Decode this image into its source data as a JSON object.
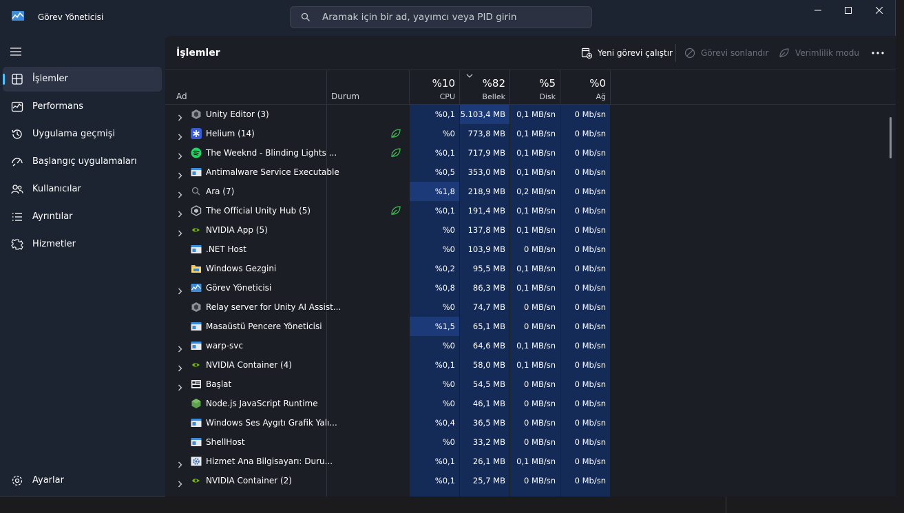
{
  "window": {
    "title": "Görev Yöneticisi",
    "search_placeholder": "Aramak için bir ad, yayımcı veya PID girin"
  },
  "sidebar": {
    "items": [
      {
        "label": "İşlemler",
        "icon": "processes-icon",
        "active": true
      },
      {
        "label": "Performans",
        "icon": "performance-icon"
      },
      {
        "label": "Uygulama geçmişi",
        "icon": "history-icon"
      },
      {
        "label": "Başlangıç uygulamaları",
        "icon": "startup-icon"
      },
      {
        "label": "Kullanıcılar",
        "icon": "users-icon"
      },
      {
        "label": "Ayrıntılar",
        "icon": "details-icon"
      },
      {
        "label": "Hizmetler",
        "icon": "services-icon"
      }
    ],
    "settings_label": "Ayarlar"
  },
  "toolbar": {
    "page_title": "İşlemler",
    "run_new_task": "Yeni görevi çalıştır",
    "end_task": "Görevi sonlandır",
    "efficiency_mode": "Verimlilik modu"
  },
  "columns": {
    "name": "Ad",
    "status": "Durum",
    "cpu": {
      "pct": "%10",
      "label": "CPU"
    },
    "memory": {
      "pct": "%82",
      "label": "Bellek"
    },
    "disk": {
      "pct": "%5",
      "label": "Disk"
    },
    "network": {
      "pct": "%0",
      "label": "Ağ"
    }
  },
  "colors": {
    "accent": "#4cc2ff",
    "highlight": "#1c3a78",
    "eco_green": "#3fb950"
  },
  "processes": [
    {
      "name": "Unity Editor (3)",
      "icon": "unity-icon",
      "expand": true,
      "eco": false,
      "cpu": "%0,1",
      "mem": "5.103,4 MB",
      "disk": "0,1 MB/sn",
      "net": "0 Mb/sn",
      "mem_hi": true
    },
    {
      "name": "Helium (14)",
      "icon": "helium-icon",
      "expand": true,
      "eco": true,
      "cpu": "%0",
      "mem": "773,8 MB",
      "disk": "0,1 MB/sn",
      "net": "0 Mb/sn"
    },
    {
      "name": "The Weeknd - Blinding Lights ...",
      "icon": "spotify-icon",
      "expand": true,
      "eco": true,
      "cpu": "%0,1",
      "mem": "717,9 MB",
      "disk": "0,1 MB/sn",
      "net": "0 Mb/sn"
    },
    {
      "name": "Antimalware Service Executable",
      "icon": "window-app-icon",
      "expand": true,
      "eco": false,
      "cpu": "%0,5",
      "mem": "353,0 MB",
      "disk": "0,1 MB/sn",
      "net": "0 Mb/sn"
    },
    {
      "name": "Ara (7)",
      "icon": "search-icon",
      "expand": true,
      "eco": false,
      "cpu": "%1,8",
      "mem": "218,9 MB",
      "disk": "0,2 MB/sn",
      "net": "0 Mb/sn",
      "cpu_hi": true
    },
    {
      "name": "The Official Unity Hub (5)",
      "icon": "unity-hub-icon",
      "expand": true,
      "eco": true,
      "cpu": "%0,1",
      "mem": "191,4 MB",
      "disk": "0,1 MB/sn",
      "net": "0 Mb/sn"
    },
    {
      "name": "NVIDIA App (5)",
      "icon": "nvidia-icon",
      "expand": true,
      "eco": false,
      "cpu": "%0",
      "mem": "137,8 MB",
      "disk": "0,1 MB/sn",
      "net": "0 Mb/sn"
    },
    {
      "name": ".NET Host",
      "icon": "window-app-icon",
      "expand": false,
      "eco": false,
      "cpu": "%0",
      "mem": "103,9 MB",
      "disk": "0 MB/sn",
      "net": "0 Mb/sn"
    },
    {
      "name": "Windows Gezgini",
      "icon": "folder-icon",
      "expand": false,
      "eco": false,
      "cpu": "%0,2",
      "mem": "95,5 MB",
      "disk": "0,1 MB/sn",
      "net": "0 Mb/sn"
    },
    {
      "name": "Görev Yöneticisi",
      "icon": "task-manager-icon",
      "expand": true,
      "eco": false,
      "cpu": "%0,8",
      "mem": "86,3 MB",
      "disk": "0,1 MB/sn",
      "net": "0 Mb/sn"
    },
    {
      "name": "Relay server for Unity AI Assist...",
      "icon": "unity-icon",
      "expand": false,
      "eco": false,
      "cpu": "%0",
      "mem": "74,7 MB",
      "disk": "0 MB/sn",
      "net": "0 Mb/sn"
    },
    {
      "name": "Masaüstü Pencere Yöneticisi",
      "icon": "window-app-icon",
      "expand": false,
      "eco": false,
      "cpu": "%1,5",
      "mem": "65,1 MB",
      "disk": "0 MB/sn",
      "net": "0 Mb/sn",
      "cpu_hi": true
    },
    {
      "name": "warp-svc",
      "icon": "window-app-icon",
      "expand": true,
      "eco": false,
      "cpu": "%0",
      "mem": "64,6 MB",
      "disk": "0,1 MB/sn",
      "net": "0 Mb/sn"
    },
    {
      "name": "NVIDIA Container (4)",
      "icon": "nvidia-icon",
      "expand": true,
      "eco": false,
      "cpu": "%0,1",
      "mem": "58,0 MB",
      "disk": "0,1 MB/sn",
      "net": "0 Mb/sn"
    },
    {
      "name": "Başlat",
      "icon": "start-icon",
      "expand": true,
      "eco": false,
      "cpu": "%0",
      "mem": "54,5 MB",
      "disk": "0 MB/sn",
      "net": "0 Mb/sn"
    },
    {
      "name": "Node.js JavaScript Runtime",
      "icon": "nodejs-icon",
      "expand": false,
      "eco": false,
      "cpu": "%0",
      "mem": "46,1 MB",
      "disk": "0 MB/sn",
      "net": "0 Mb/sn"
    },
    {
      "name": "Windows Ses Aygıtı Grafik Yalı...",
      "icon": "window-app-icon",
      "expand": false,
      "eco": false,
      "cpu": "%0,4",
      "mem": "36,5 MB",
      "disk": "0 MB/sn",
      "net": "0 Mb/sn"
    },
    {
      "name": "ShellHost",
      "icon": "window-app-icon",
      "expand": false,
      "eco": false,
      "cpu": "%0",
      "mem": "33,2 MB",
      "disk": "0 MB/sn",
      "net": "0 Mb/sn"
    },
    {
      "name": "Hizmet Ana Bilgisayarı: Duru...",
      "icon": "gear-service-icon",
      "expand": true,
      "eco": false,
      "cpu": "%0,1",
      "mem": "26,1 MB",
      "disk": "0,1 MB/sn",
      "net": "0 Mb/sn"
    },
    {
      "name": "NVIDIA Container (2)",
      "icon": "nvidia-icon",
      "expand": true,
      "eco": false,
      "cpu": "%0,1",
      "mem": "25,7 MB",
      "disk": "0 MB/sn",
      "net": "0 Mb/sn"
    }
  ]
}
